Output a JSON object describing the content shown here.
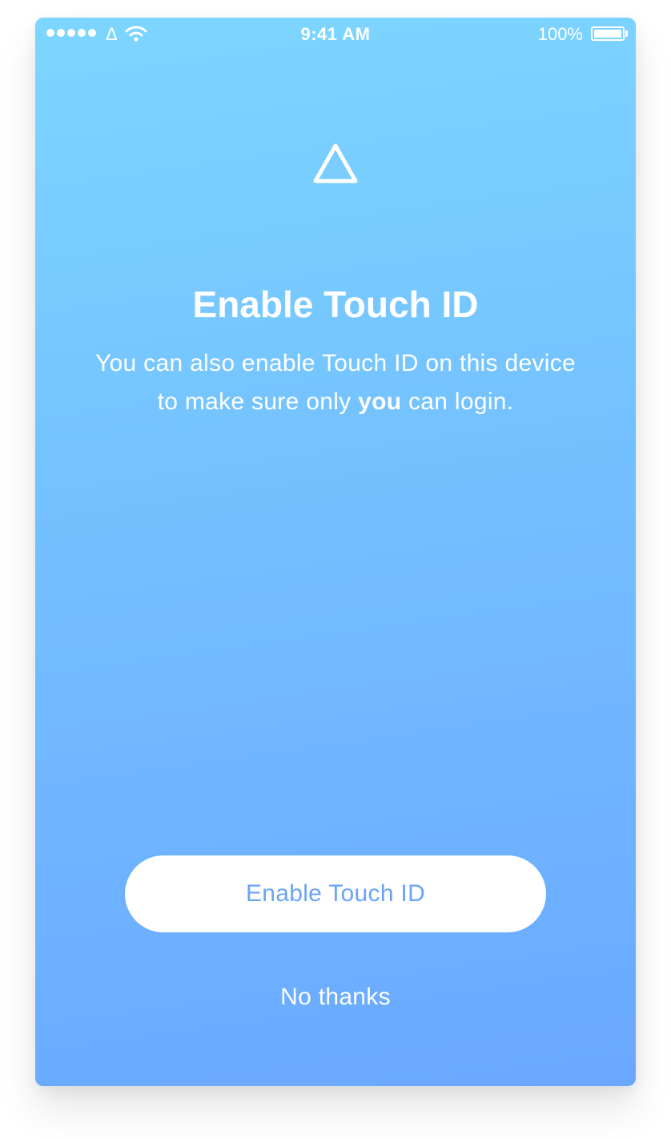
{
  "status_bar": {
    "carrier": "Δ",
    "time": "9:41 AM",
    "battery_percent": "100%",
    "signal_bars": 5,
    "battery_level": 1.0
  },
  "screen": {
    "logo_icon": "triangle-icon",
    "title": "Enable Touch ID",
    "subtitle_before": "You can also enable Touch ID on this device to make sure only ",
    "subtitle_bold": "you",
    "subtitle_after": " can login."
  },
  "actions": {
    "enable_label": "Enable Touch ID",
    "dismiss_label": "No thanks"
  },
  "colors": {
    "gradient_top": "#7dd6ff",
    "gradient_bottom": "#6aa8ff",
    "button_text": "#6aa4f7",
    "foreground": "#ffffff"
  }
}
